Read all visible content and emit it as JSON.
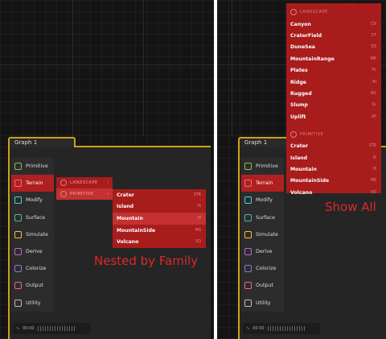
{
  "graph_tab_label": "Graph 1",
  "sidebar": [
    {
      "label": "Primitive",
      "icon": "cube-icon",
      "color": "#8bc34a"
    },
    {
      "label": "Terrain",
      "icon": "terrain-icon",
      "color": "#e57373"
    },
    {
      "label": "Modify",
      "icon": "modify-icon",
      "color": "#4dd0e1"
    },
    {
      "label": "Surface",
      "icon": "surface-icon",
      "color": "#4db6ac"
    },
    {
      "label": "Simulate",
      "icon": "simulate-icon",
      "color": "#ffb74d"
    },
    {
      "label": "Derive",
      "icon": "derive-icon",
      "color": "#ba68c8"
    },
    {
      "label": "Colorize",
      "icon": "colorize-icon",
      "color": "#9575cd"
    },
    {
      "label": "Output",
      "icon": "output-icon",
      "color": "#f06292"
    },
    {
      "label": "Utility",
      "icon": "utility-icon",
      "color": "#bdbdbd"
    }
  ],
  "nested_families": [
    "LANDSCAPE",
    "PRIMITIVE"
  ],
  "nested_items": [
    {
      "label": "Crater",
      "hotkey": "STR"
    },
    {
      "label": "Island",
      "hotkey": "IS"
    },
    {
      "label": "Mountain",
      "hotkey": "M"
    },
    {
      "label": "MountainSide",
      "hotkey": "MS"
    },
    {
      "label": "Volcano",
      "hotkey": "VO"
    }
  ],
  "all_landscape_header": "LANDSCAPE",
  "all_landscape_items": [
    {
      "label": "Canyon",
      "hotkey": "CN"
    },
    {
      "label": "CraterField",
      "hotkey": "CF"
    },
    {
      "label": "DuneSea",
      "hotkey": "DS"
    },
    {
      "label": "MountainRange",
      "hotkey": "MR"
    },
    {
      "label": "Plates",
      "hotkey": "PL"
    },
    {
      "label": "Ridge",
      "hotkey": "RI"
    },
    {
      "label": "Rugged",
      "hotkey": "RG"
    },
    {
      "label": "Slump",
      "hotkey": "SL"
    },
    {
      "label": "Uplift",
      "hotkey": "UP"
    }
  ],
  "all_primitive_header": "PRIMITIVE",
  "all_primitive_items": [
    {
      "label": "Crater",
      "hotkey": "STR"
    },
    {
      "label": "Island",
      "hotkey": "IS"
    },
    {
      "label": "Mountain",
      "hotkey": "M"
    },
    {
      "label": "MountainSide",
      "hotkey": "MS"
    },
    {
      "label": "Volcano",
      "hotkey": "VO"
    }
  ],
  "timeline_time": "00:00",
  "caption_left": "Nested by Family",
  "caption_right": "Show All"
}
